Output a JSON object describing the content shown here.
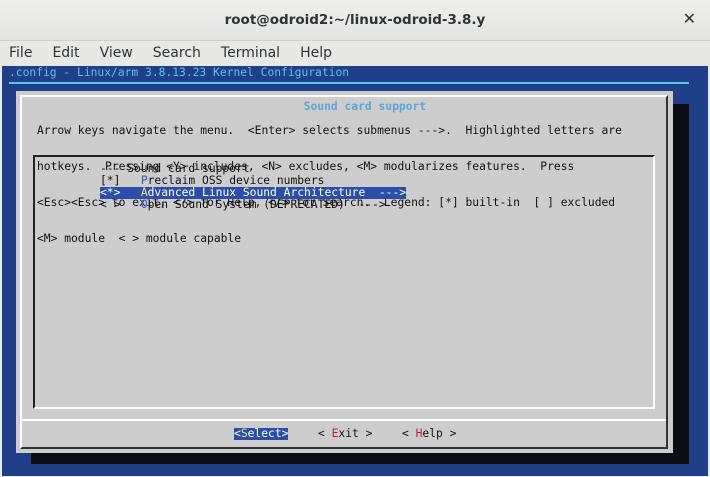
{
  "window": {
    "title": "root@odroid2:~/linux-odroid-3.8.y",
    "close_glyph": "✕"
  },
  "menubar": {
    "items": [
      "File",
      "Edit",
      "View",
      "Search",
      "Terminal",
      "Help"
    ]
  },
  "terminal": {
    "backtitle": ".config - Linux/arm 3.8.13.23 Kernel Configuration",
    "dialog_title": "Sound card support",
    "help_lines": [
      "Arrow keys navigate the menu.  <Enter> selects submenus --->.  Highlighted letters are",
      "hotkeys.  Pressing <Y> includes, <N> excludes, <M> modularizes features.  Press",
      "<Esc><Esc> to exit, <?> for Help, </> for Search.  Legend: [*] built-in  [ ] excluded",
      "<M> module  < > module capable"
    ],
    "menu": {
      "header": "--- Sound card support",
      "items": [
        {
          "state": "[*]",
          "hotkey": "P",
          "rest": "reclaim OSS device numbers",
          "suffix": ""
        },
        {
          "state": "<*>",
          "hotkey": "A",
          "rest": "dvanced Linux Sound Architecture",
          "suffix": "  --->"
        },
        {
          "state": "< >",
          "hotkey": "O",
          "rest": "pen Sound System (DEPRECATED)",
          "suffix": "  --->"
        }
      ]
    },
    "buttons": {
      "select": {
        "pre": "<",
        "accent": "S",
        "post": "elect>"
      },
      "exit": {
        "pre": "< ",
        "accent": "E",
        "post": "xit >"
      },
      "help": {
        "pre": "< ",
        "accent": "H",
        "post": "elp >"
      }
    }
  }
}
